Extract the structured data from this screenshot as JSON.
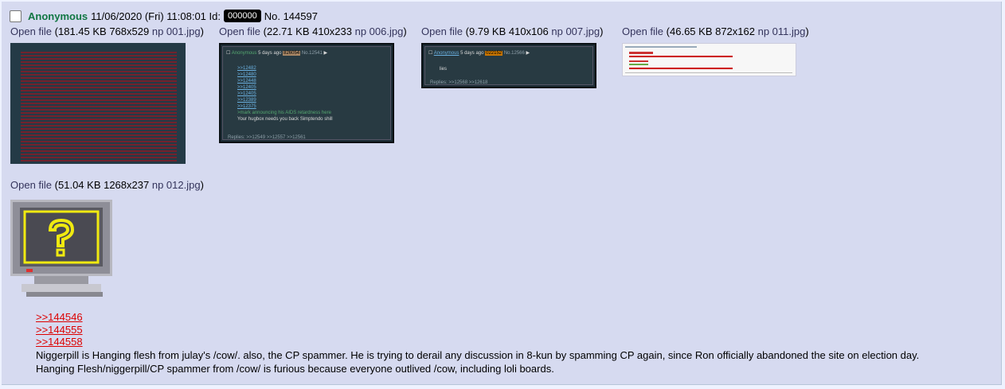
{
  "post": {
    "name": "Anonymous",
    "datetime": "11/06/2020 (Fri) 11:08:01",
    "id_label": "Id:",
    "id_value": "000000",
    "no_label": "No.",
    "post_number": "144597"
  },
  "files": [
    {
      "open_label": "Open file",
      "details": "(181.45 KB 768x529",
      "name": "np 001.jpg",
      "close": ")"
    },
    {
      "open_label": "Open file",
      "details": "(22.71 KB 410x233",
      "name": "np 006.jpg",
      "close": ")"
    },
    {
      "open_label": "Open file",
      "details": "(9.79 KB 410x106",
      "name": "np 007.jpg",
      "close": ")"
    },
    {
      "open_label": "Open file",
      "details": "(46.65 KB 872x162",
      "name": "np 011.jpg",
      "close": ")"
    },
    {
      "open_label": "Open file",
      "details": "(51.04 KB 1268x237",
      "name": "np 012.jpg",
      "close": ")"
    }
  ],
  "thumbs": {
    "t2": {
      "name": "Anonymous",
      "ago": "5 days ago",
      "id": "826054",
      "no": "No.12541",
      "links": [
        ">>12482",
        ">>12480",
        ">>12448",
        ">>12405",
        ">>12405",
        ">>12389",
        ">>12375"
      ],
      "greentext": ">mark announcing his AIDS retardness here",
      "text": "Your hugbox needs you back Simptendo shill",
      "replies": "Replies: >>12549 >>12557 >>12561"
    },
    "t3": {
      "name": "Anonymous",
      "ago": "5 days ago",
      "id": "022152",
      "no": "No.12566",
      "text": "lies",
      "replies": "Replies: >>12568 >>12618"
    }
  },
  "quotes": [
    ">>144546",
    ">>144555",
    ">>144558"
  ],
  "message": [
    "Niggerpill is Hanging flesh from julay's /cow/. also, the CP spammer. He is trying to derail any discussion in 8-kun by spamming CP again, since Ron officially abandoned the site on election day.",
    "Hanging Flesh/niggerpill/CP spammer from /cow/ is furious because everyone outlived /cow, including loli boards."
  ]
}
